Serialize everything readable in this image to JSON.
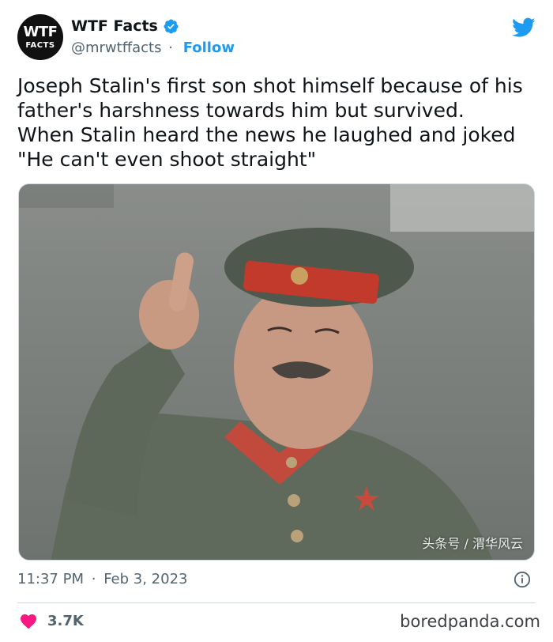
{
  "account": {
    "avatar_line1": "WTF",
    "avatar_line2": "FACTS",
    "display_name": "WTF Facts",
    "handle": "@mrwtffacts",
    "separator": "·",
    "follow_label": "Follow"
  },
  "tweet": {
    "text": "Joseph Stalin's first son shot himself because of his\nfather's harshness towards him but survived.\nWhen Stalin heard the news he laughed and joked\n\"He can't even shoot straight\"",
    "image_watermark": "头条号 / 渭华风云",
    "time": "11:37 PM",
    "date_separator": "·",
    "date": "Feb 3, 2023",
    "likes": "3.7K"
  },
  "footer": {
    "source": "boredpanda.com"
  },
  "icons": {
    "verified": "verified-badge-icon",
    "bird": "twitter-bird-icon",
    "info": "info-icon",
    "heart": "heart-icon"
  },
  "colors": {
    "twitter_blue": "#1d9bf0",
    "like_red": "#f91880",
    "text_primary": "#0f1419",
    "text_secondary": "#536471"
  }
}
